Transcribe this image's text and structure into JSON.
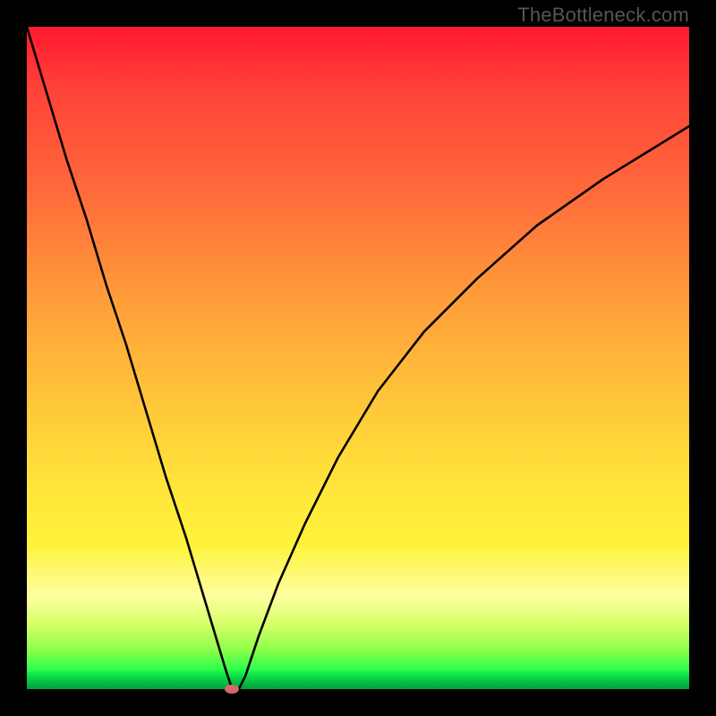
{
  "watermark": "TheBottleneck.com",
  "chart_data": {
    "type": "line",
    "title": "",
    "xlabel": "",
    "ylabel": "",
    "xlim": [
      0,
      100
    ],
    "ylim": [
      0,
      100
    ],
    "grid": false,
    "legend": null,
    "background_gradient": {
      "stops": [
        {
          "pos": 0,
          "color": "#ff1a2f"
        },
        {
          "pos": 10,
          "color": "#ff4438"
        },
        {
          "pos": 25,
          "color": "#ff6a3a"
        },
        {
          "pos": 40,
          "color": "#ff9a3a"
        },
        {
          "pos": 55,
          "color": "#ffc23a"
        },
        {
          "pos": 68,
          "color": "#ffe23a"
        },
        {
          "pos": 78,
          "color": "#fff23a"
        },
        {
          "pos": 86,
          "color": "#fdffa0"
        },
        {
          "pos": 90,
          "color": "#d8ff6a"
        },
        {
          "pos": 94,
          "color": "#8fff4a"
        },
        {
          "pos": 97,
          "color": "#2eff4a"
        },
        {
          "pos": 98,
          "color": "#0bdc49"
        },
        {
          "pos": 100,
          "color": "#009e3e"
        }
      ]
    },
    "series": [
      {
        "name": "bottleneck-curve",
        "color": "#000000",
        "x": [
          0,
          3,
          6,
          9,
          12,
          15,
          18,
          21,
          24,
          27,
          30,
          31,
          32,
          33,
          35,
          38,
          42,
          47,
          53,
          60,
          68,
          77,
          87,
          100
        ],
        "y": [
          100,
          90,
          80,
          71,
          61,
          52,
          42,
          32,
          23,
          13,
          3,
          0,
          0,
          2,
          8,
          16,
          25,
          35,
          45,
          54,
          62,
          70,
          77,
          85
        ]
      }
    ],
    "marker": {
      "name": "optimal-point",
      "x": 31,
      "y": 0,
      "color": "#d46a6a"
    }
  }
}
